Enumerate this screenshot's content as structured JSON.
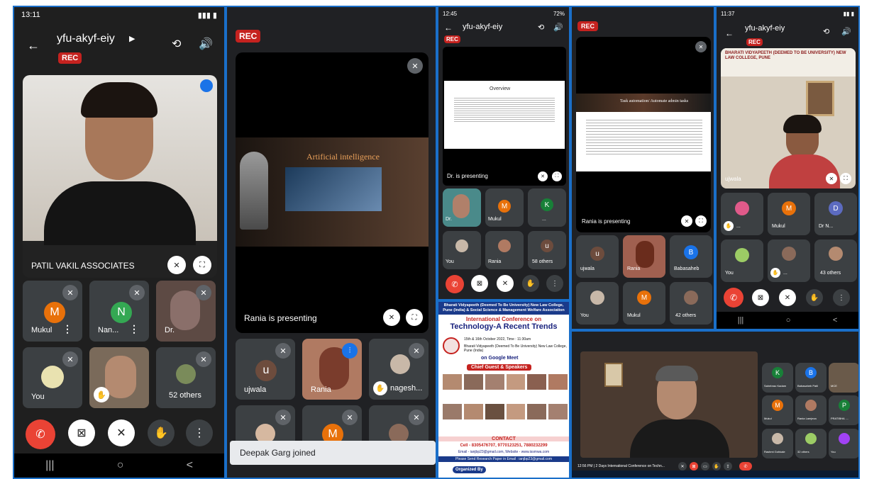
{
  "p1": {
    "time": "13:11",
    "meeting_code": "yfu-akyf-eiy",
    "rec": "REC",
    "main_speaker": "PATIL VAKIL ASSOCIATES",
    "tiles": [
      {
        "initial": "M",
        "name": "Mukul",
        "color": "#e8710a"
      },
      {
        "initial": "N",
        "name": "Nan...",
        "color": "#34a853"
      },
      {
        "name": "Dr."
      },
      {
        "name": "You"
      },
      {
        "name": ""
      },
      {
        "name": "52 others"
      }
    ]
  },
  "p2": {
    "rec": "REC",
    "slide_title": "Artificial intelligence",
    "presenting": "Rania is presenting",
    "tiles": [
      {
        "initial": "u",
        "name": "ujwala",
        "color": "#6d4c3d"
      },
      {
        "name": "Rania"
      },
      {
        "name": "nagesh..."
      },
      {
        "name": ""
      },
      {
        "initial": "M",
        "name": "",
        "color": "#e8710a"
      },
      {
        "name": ""
      }
    ],
    "toast": "Deepak Garg joined"
  },
  "p3": {
    "time": "12:45",
    "meeting_code": "yfu-akyf-eiy",
    "battery": "72%",
    "rec": "REC",
    "slide_heading": "Overview",
    "presenting": "Dr. is presenting",
    "tiles": [
      {
        "name": "Dr."
      },
      {
        "initial": "M",
        "name": "Mukul",
        "color": "#e8710a"
      },
      {
        "initial": "K",
        "name": "...",
        "color": "#188038"
      },
      {
        "name": "You"
      },
      {
        "name": "Rania"
      },
      {
        "initial": "u",
        "name": "58 others",
        "color": "#6d4c3d"
      }
    ]
  },
  "p4": {
    "rec": "REC",
    "slide_heading": "Task automation/ Automate admin tasks",
    "presenting": "Rania is presenting",
    "tiles": [
      {
        "initial": "u",
        "name": "ujwala",
        "color": "#6d4c3d"
      },
      {
        "name": "Rania"
      },
      {
        "initial": "B",
        "name": "Babasaheb",
        "color": "#1a73e8"
      },
      {
        "name": "You"
      },
      {
        "initial": "M",
        "name": "Mukul",
        "color": "#e8710a"
      },
      {
        "name": "42 others"
      }
    ]
  },
  "p5": {
    "time": "11:37",
    "meeting_code": "yfu-akyf-eiy",
    "rec": "REC",
    "main_speaker": "ujwala",
    "banner": "BHARATI VIDYAPEETH (DEEMED TO BE UNIVERSITY) NEW LAW COLLEGE, PUNE",
    "tiles": [
      {
        "name": "..."
      },
      {
        "initial": "M",
        "name": "Mukul",
        "color": "#e8710a"
      },
      {
        "initial": "D",
        "name": "Dr N...",
        "color": "#5c6bc0"
      },
      {
        "name": "You"
      },
      {
        "name": "..."
      },
      {
        "name": "43 others"
      }
    ]
  },
  "poster": {
    "org": "Bharati Vidyapeeth (Deemed To Be University) New Law College, Pune (India) & Social Science & Management Welfare Association",
    "conf": "International Conference on",
    "title": "Technology-A Recent Trends",
    "date_line": "15th & 16th October 2022, Time : 11:30am",
    "venue": "Bharati Vidyapeeth (Deemed To Be University) New Law College, Pune (India)",
    "platform": "on Google Meet",
    "chief": "Chief Guest & Speakers",
    "contact": "CONTACT",
    "phones": "Cell - 8305476707, 9770123251, 7880232299",
    "email": "Email - ianjbp23@gmail.com, Website - www.issmwa.com",
    "send": "Please Send Research Paper in Email : ianjbp23@gmail.com",
    "organized": "Organized By"
  },
  "desktop": {
    "bar_text": "12:56 PM | 2 Days International Conference on Techn...",
    "tiles": [
      {
        "initial": "K",
        "color": "#188038",
        "name": "Sahebrao Kadam"
      },
      {
        "initial": "B",
        "color": "#1a73e8",
        "name": "Babasaheb Patil"
      },
      {
        "name": "MCE"
      },
      {
        "initial": "M",
        "color": "#e8710a",
        "name": "Mukul"
      },
      {
        "name": "Rania Lamjeza"
      },
      {
        "initial": "P",
        "color": "#188038",
        "name": "PRATIBHA ...."
      },
      {
        "name": "Rashmi Gohkale"
      },
      {
        "name": "32 others"
      },
      {
        "initial": "",
        "color": "#a142f4",
        "name": "You"
      }
    ]
  }
}
